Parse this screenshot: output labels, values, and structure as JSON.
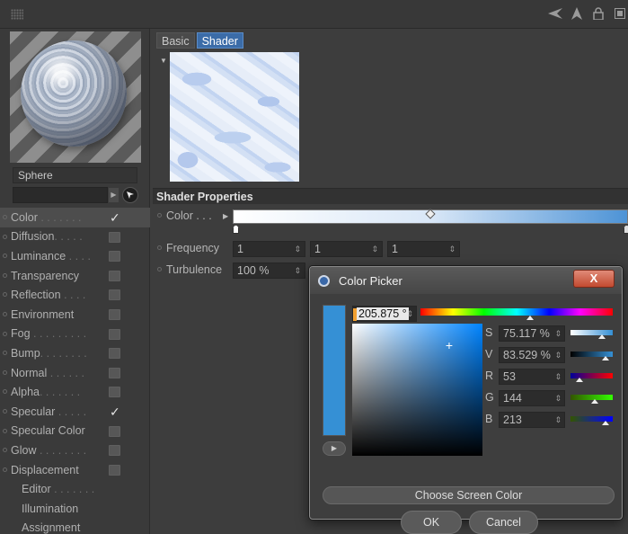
{
  "toolbar": {
    "icons": [
      "back-arrow-icon",
      "cursor-icon",
      "lock-icon",
      "new-window-icon"
    ]
  },
  "material": {
    "object_name": "Sphere",
    "object_field": ""
  },
  "channels": [
    {
      "label": "Color",
      "dots": " . . . . . . .",
      "checked": true,
      "has_box": true,
      "active": true
    },
    {
      "label": "Diffusion",
      "dots": ". . . . .",
      "checked": false,
      "has_box": true
    },
    {
      "label": "Luminance",
      "dots": " . . . .",
      "checked": false,
      "has_box": true
    },
    {
      "label": "Transparency",
      "dots": "",
      "checked": false,
      "has_box": true
    },
    {
      "label": "Reflection",
      "dots": " . . . .",
      "checked": false,
      "has_box": true
    },
    {
      "label": "Environment",
      "dots": "",
      "checked": false,
      "has_box": true
    },
    {
      "label": "Fog",
      "dots": " . . . . . . . . .",
      "checked": false,
      "has_box": true
    },
    {
      "label": "Bump",
      "dots": ". . . . . . . .",
      "checked": false,
      "has_box": true
    },
    {
      "label": "Normal",
      "dots": " . . . . . .",
      "checked": false,
      "has_box": true
    },
    {
      "label": "Alpha",
      "dots": ". . . . . . .",
      "checked": false,
      "has_box": true
    },
    {
      "label": "Specular",
      "dots": " . . . . .",
      "checked": true,
      "has_box": true
    },
    {
      "label": "Specular Color",
      "dots": "",
      "checked": false,
      "has_box": true
    },
    {
      "label": "Glow",
      "dots": " . . . . . . . .",
      "checked": false,
      "has_box": true
    },
    {
      "label": "Displacement",
      "dots": "",
      "checked": false,
      "has_box": true
    },
    {
      "label": "Editor",
      "dots": " . . . . . . .",
      "checked": false,
      "has_box": false
    },
    {
      "label": "Illumination",
      "dots": "",
      "checked": false,
      "has_box": false
    },
    {
      "label": "Assignment",
      "dots": "",
      "checked": false,
      "has_box": false
    }
  ],
  "tabs": [
    {
      "label": "Basic",
      "active": false
    },
    {
      "label": "Shader",
      "active": true
    }
  ],
  "shader": {
    "header": "Shader Properties",
    "color_label": "Color . . .",
    "frequency_label": "Frequency",
    "frequency_values": [
      "1",
      "1",
      "1"
    ],
    "turbulence_label": "Turbulence",
    "turbulence_value": "100 %"
  },
  "color_picker": {
    "title": "Color Picker",
    "close_label": "X",
    "hue_value": "205.875 °",
    "hue": 205.875,
    "swatch_color": "#3590d5",
    "sliders": [
      {
        "label": "S",
        "value": "75.117 %",
        "level": 0.75117,
        "track": "linear-gradient(90deg,#fff,#3590d5)"
      },
      {
        "label": "V",
        "value": "83.529 %",
        "level": 0.83529,
        "track": "linear-gradient(90deg,#000,#3590d5)"
      },
      {
        "label": "R",
        "value": "53",
        "level": 0.2078,
        "track": "linear-gradient(90deg,#009,#f00)"
      },
      {
        "label": "G",
        "value": "144",
        "level": 0.5647,
        "track": "linear-gradient(90deg,#350,#3f0)"
      },
      {
        "label": "B",
        "value": "213",
        "level": 0.8353,
        "track": "linear-gradient(90deg,#350,#00f)"
      }
    ],
    "screen_color_label": "Choose Screen Color",
    "ok_label": "OK",
    "cancel_label": "Cancel"
  }
}
